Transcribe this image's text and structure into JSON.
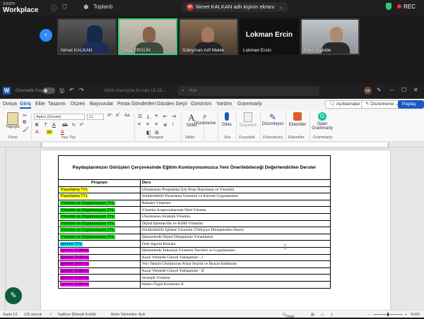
{
  "zoom": {
    "logo_top": "zoom",
    "logo_bottom": "Workplace",
    "meeting_label": "Toplantı",
    "share_initials": "NK",
    "share_text": "Nimet KALKAN adlı kişinin ekranı",
    "rec_label": "REC"
  },
  "gallery": {
    "prev_arrow": "‹",
    "participants": [
      {
        "name": "Nimet KALKAN",
        "active": false
      },
      {
        "name": "Tolga ERGÜN",
        "active": true
      },
      {
        "name": "Süleyman Arif Melek",
        "active": false
      },
      {
        "name": "Lokman Ercin",
        "active": false
      },
      {
        "name": "Elvin İlzabide",
        "active": false
      }
    ],
    "text_tile_name": "Lokman Ercin"
  },
  "word": {
    "app_icon": "W",
    "autosave": "Otomatik Kaydet",
    "doc_name": "Birim Danışma Kurulu 15.05...",
    "search_placeholder": "Ara",
    "avatar_initials": "NK",
    "menu": [
      "Dosya",
      "Giriş",
      "Ekle",
      "Tasarım",
      "Düzen",
      "Başvurular",
      "Posta Gönderileri",
      "Gözden Geçir",
      "Görünüm",
      "Yardım",
      "Grammarly"
    ],
    "active_menu": "Giriş",
    "comments_btn": "Açıklamalar",
    "edit_btn": "Düzenleme",
    "share_btn": "Paylaş",
    "ribbon": {
      "paste": "Yapıştır",
      "font_name": "Aptos (Gövde)",
      "font_size": "11",
      "styles": "Stiller",
      "editing": "Düzenleme",
      "dictate": "Dikte",
      "sensitivity": "Duyarlılık",
      "editor": "Düzenleyici",
      "add_ins": "Eklentiler",
      "grammarly_open": "Open",
      "grammarly_label": "Grammarly",
      "groups": {
        "clipboard": "Pano",
        "font": "Yazı Tipi",
        "paragraph": "Paragraf",
        "styles": "Stiller",
        "voice": "Ses",
        "sensitivity": "Duyarlılık",
        "editor": "Düzenleyici",
        "add_ins": "Eklentiler",
        "grammarly": "Grammarly"
      }
    },
    "status": {
      "page": "Sayfa 1/1",
      "words": "125 sözcük",
      "lang": "İngilizce (Birleşik Krallık)",
      "predictions": "Metin Tahminleri: Açık",
      "focus": "Odak",
      "zoom": "%100"
    }
  },
  "document": {
    "caption": "Paydaşlarımızın Görüşleri Çerçevesinde Eğitim Komisyonumuzca Yeni Önerilebileceği Değerlendirilen Dersler",
    "col_program": "Program",
    "col_course": "Ders",
    "colors": {
      "yellow": "#ffff00",
      "green": "#00e000",
      "cyan": "#00e5ff",
      "magenta": "#ff00ff"
    },
    "rows": [
      {
        "program": "Pazarlama TYL",
        "hl": "yellow",
        "course": "Uluslararası Programlar İçin Proje Hazırlama ve Yönetimi"
      },
      {
        "program": "Pazarlama TYL",
        "hl": "yellow",
        "course": "Sürdürülebilir Pazarlama Yönetimi ve Küresel Uygulamaları"
      },
      {
        "program": "Yönetim ve Organizasyon TYL",
        "hl": "green",
        "course": "Rekabet Yönetimi"
      },
      {
        "program": "Yönetim ve Organizasyon TYL",
        "hl": "green",
        "course": "Yönetim Araştırmalarında Nitel Yöntem"
      },
      {
        "program": "Yönetim ve Organizasyon TYL",
        "hl": "green",
        "course": "Uluslararası Stratejik Yönetim"
      },
      {
        "program": "Yönetim ve Organizasyon TYL",
        "hl": "green",
        "course": "Dijital İşletmecilik ve KOBİ Yönetimi"
      },
      {
        "program": "Yönetim ve Organizasyon TYL",
        "hl": "green",
        "course": "Sürdürülebilir İşletme Yönetimi (Türkçeye Dönüştürülen Öneri)"
      },
      {
        "program": "Yönetim ve Organizasyon TYL",
        "hl": "green",
        "course": "İşletmelerde Dijital Dönüşümün Yönetilmesi"
      },
      {
        "program": "İşletme TYL",
        "hl": "cyan",
        "course": "Özel Sigorta Hukuku"
      },
      {
        "program": "İşletme Doktora",
        "hl": "magenta",
        "course": "İşletmelerde Teknoloji Yönetimi Teorileri ve Uygulamaları"
      },
      {
        "program": "İşletme Doktora",
        "hl": "magenta",
        "course": "Karar Vermede Güncel Yaklaşımlar - I"
      },
      {
        "program": "İşletme Doktora",
        "hl": "magenta",
        "course": "Veri Tabanlı Uluslararası Pazar Seçimi ve İhracat İstihbaratı"
      },
      {
        "program": "İşletme Doktora",
        "hl": "magenta",
        "course": "Karar Vermede Güncel Yaklaşımlar - II"
      },
      {
        "program": "İşletme Doktora",
        "hl": "magenta",
        "course": "Stratejik Yönetim"
      },
      {
        "program": "İşletme Doktora",
        "hl": "magenta",
        "course": "Makro Örgüt Kuramları II"
      }
    ]
  }
}
